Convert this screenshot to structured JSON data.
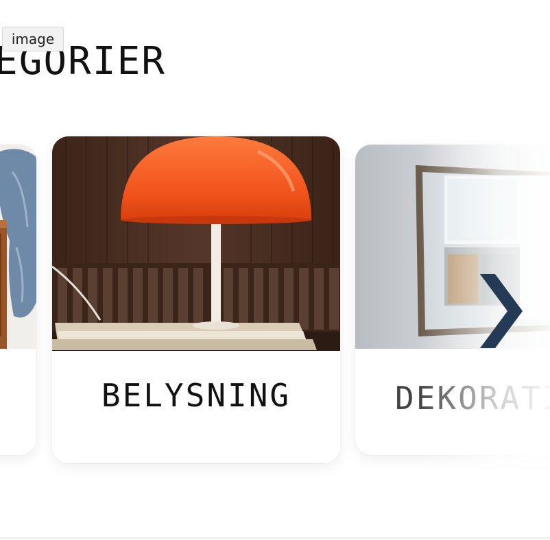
{
  "tooltip": {
    "text": "image"
  },
  "section": {
    "title": "EGORIER"
  },
  "cards": [
    {
      "label": "",
      "image": "person-denim-wooden-chair-photo"
    },
    {
      "label": "BELYSNING",
      "image": "orange-mushroom-lamp-photo"
    },
    {
      "label": "DEKORATI",
      "image": "wall-mirror-window-photo"
    }
  ],
  "carousel": {
    "next_icon": "chevron-right-icon",
    "arrow_color": "#253a55"
  },
  "colors": {
    "lamp_orange": "#f05a1e",
    "wood_brown": "#4a2e1f"
  }
}
